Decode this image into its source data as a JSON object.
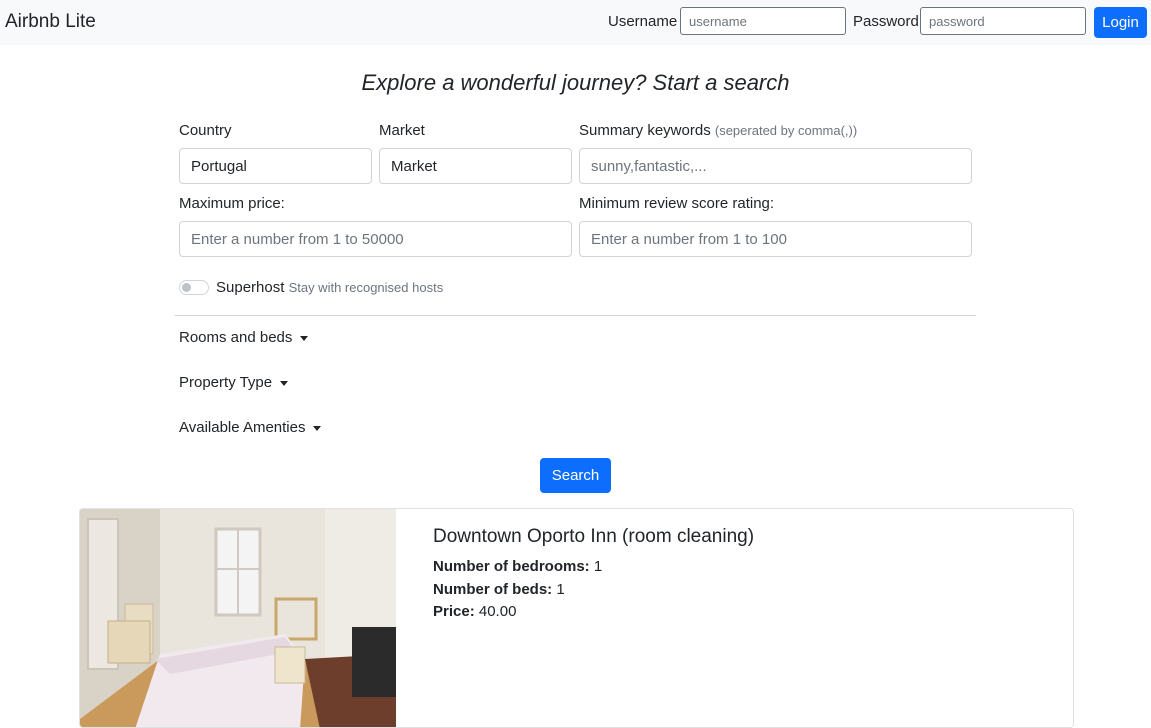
{
  "navbar": {
    "brand": "Airbnb Lite",
    "username_label": "Username",
    "username_placeholder": "username",
    "password_label": "Password",
    "password_placeholder": "password",
    "login_label": "Login"
  },
  "search": {
    "heading": "Explore a wonderful journey? Start a search",
    "country_label": "Country",
    "country_value": "Portugal",
    "market_label": "Market",
    "market_value": "Market",
    "keywords_label": "Summary keywords",
    "keywords_hint": "(seperated by comma(,))",
    "keywords_placeholder": "sunny,fantastic,...",
    "max_price_label": "Maximum price:",
    "max_price_placeholder": "Enter a number from 1 to 50000",
    "min_review_label": "Minimum review score rating:",
    "min_review_placeholder": "Enter a number from 1 to 100",
    "superhost_label": "Superhost",
    "superhost_hint": "Stay with recognised hosts",
    "superhost_enabled": false,
    "rooms_toggle": "Rooms and beds",
    "property_toggle": "Property Type",
    "amenities_toggle": "Available Amenties",
    "search_button": "Search"
  },
  "results": [
    {
      "title": "Downtown Oporto Inn (room cleaning)",
      "bedrooms_label": "Number of bedrooms:",
      "bedrooms": "1",
      "beds_label": "Number of beds:",
      "beds": "1",
      "price_label": "Price:",
      "price": "40.00",
      "image": "bedroom-photo"
    }
  ],
  "colors": {
    "primary": "#0d6efd",
    "navbar_bg": "#f8f9fa",
    "border": "#ced4da",
    "muted": "#6c757d"
  }
}
